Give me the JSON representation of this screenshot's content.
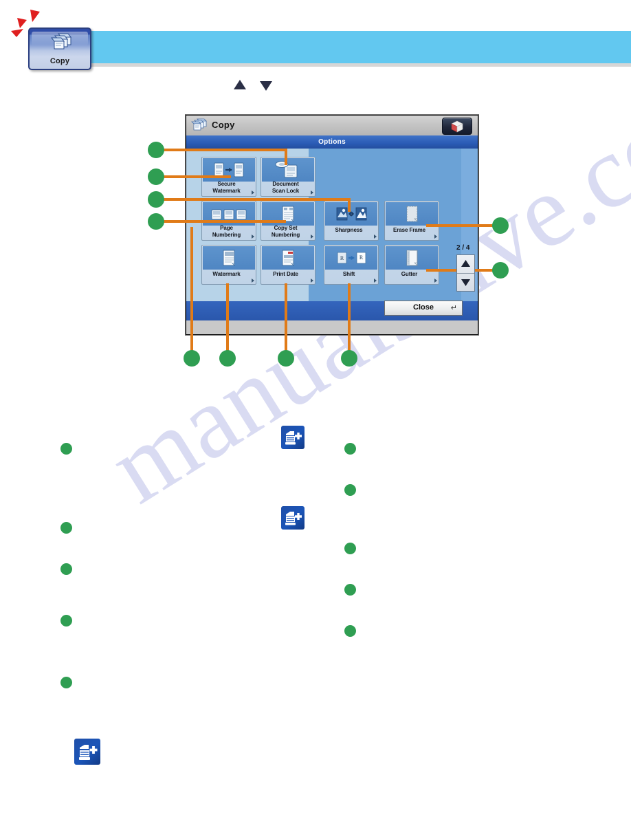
{
  "document": {
    "watermark_text": "manualshive.com"
  },
  "top": {
    "tab_label": "Copy",
    "tab_icon": "copy-stack-icon",
    "flash_marks": "red-attention-arrows",
    "nav_up": "▲",
    "nav_down": "▼",
    "banner_color": "#62c8f0"
  },
  "panel": {
    "title": "Copy",
    "title_icon": "copy-stack-icon",
    "cube_button_icon": "3d-cube-icon",
    "section_title": "Options",
    "page_indicator": "2 / 4",
    "scroll_up": "▲",
    "scroll_down": "▼",
    "close_label": "Close",
    "close_enter_glyph": "↵",
    "buttons": [
      {
        "id": "secure-watermark",
        "label": "Secure\nWatermark",
        "line1": "Secure",
        "line2": "Watermark",
        "icon": "two-sheets-arrow-icon"
      },
      {
        "id": "document-scan-lock",
        "label": "Document\nScan Lock",
        "line1": "Document",
        "line2": "Scan Lock",
        "icon": "scan-lock-icon"
      },
      {
        "id": "page-numbering",
        "label": "Page\nNumbering",
        "line1": "Page",
        "line2": "Numbering",
        "icon": "three-pages-icon"
      },
      {
        "id": "copy-set-numbering",
        "label": "Copy Set\nNumbering",
        "line1": "Copy Set",
        "line2": "Numbering",
        "icon": "numbered-page-icon"
      },
      {
        "id": "sharpness",
        "label": "Sharpness",
        "line1": "Sharpness",
        "line2": "",
        "icon": "sharpness-compare-icon"
      },
      {
        "id": "erase-frame",
        "label": "Erase Frame",
        "line1": "Erase Frame",
        "line2": "",
        "icon": "erase-frame-icon"
      },
      {
        "id": "watermark",
        "label": "Watermark",
        "line1": "Watermark",
        "line2": "",
        "icon": "watermark-page-icon"
      },
      {
        "id": "print-date",
        "label": "Print Date",
        "line1": "Print Date",
        "line2": "",
        "icon": "print-date-icon"
      },
      {
        "id": "shift",
        "label": "Shift",
        "line1": "Shift",
        "line2": "",
        "icon": "shift-arrow-icon"
      },
      {
        "id": "gutter",
        "label": "Gutter",
        "line1": "Gutter",
        "line2": "",
        "icon": "gutter-page-icon"
      }
    ]
  },
  "callouts": {
    "diagram_left": [
      {
        "target": "document-scan-lock"
      },
      {
        "target": "secure-watermark"
      },
      {
        "target": "copy-set-numbering"
      },
      {
        "target": "sharpness"
      }
    ],
    "diagram_right": [
      {
        "target": "erase-frame"
      },
      {
        "target": "gutter"
      }
    ],
    "diagram_bottom": [
      {
        "target": "page-numbering"
      },
      {
        "target": "watermark"
      },
      {
        "target": "print-date"
      },
      {
        "target": "shift"
      }
    ],
    "body_left_count": 5,
    "body_right_count": 5
  },
  "body_icons": {
    "printer_plus": "printer-add-icon",
    "count": 3
  },
  "colors": {
    "callout_green": "#2f9e52",
    "leader_orange": "#e07b18",
    "banner_cyan": "#62c8f0",
    "panel_blue": "#2a5bb5",
    "accent_red": "#e02020"
  }
}
